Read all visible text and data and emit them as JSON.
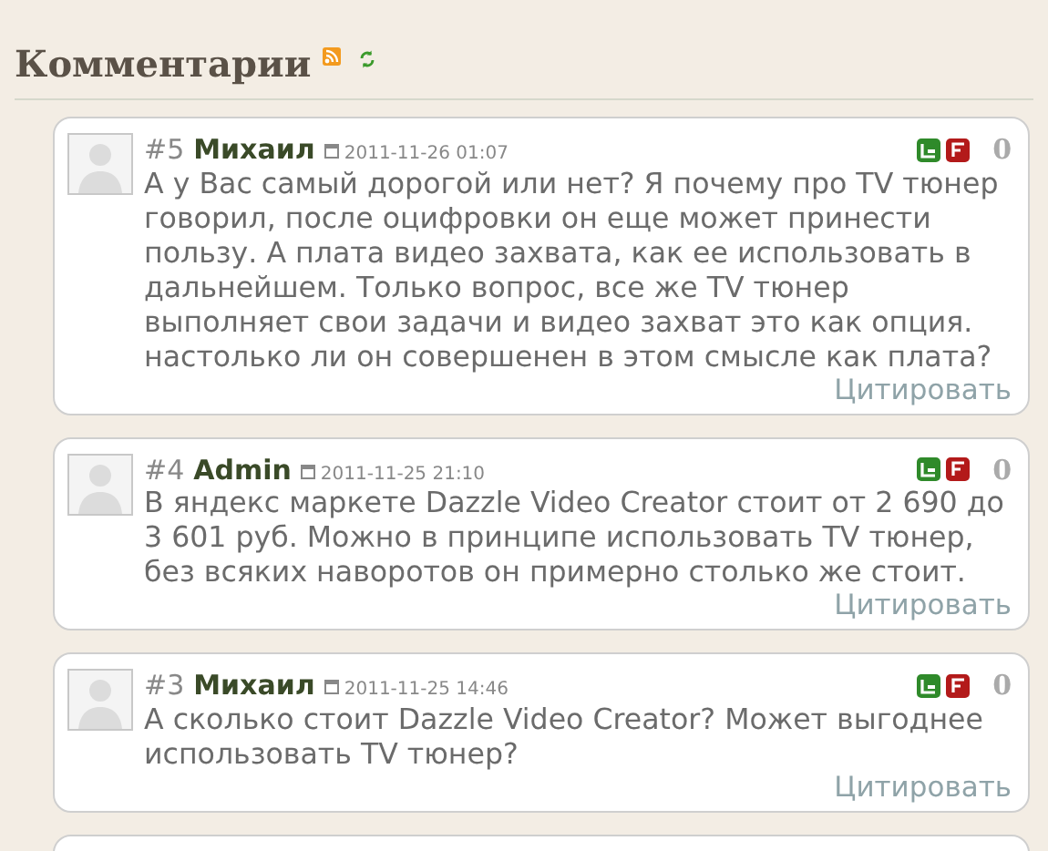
{
  "section": {
    "title": "Комментарии"
  },
  "comments": [
    {
      "number": "#5",
      "author": "Михаил",
      "date": "2011-11-26 01:07",
      "rating": "0",
      "text": "А у Вас самый дорогой или нет? Я почему про TV тюнер говорил, после оцифровки он еще может принести пользу. А плата видео захвата, как ее использовать в дальнейшем. Только вопрос, все же TV тюнер выполняет свои задачи и видео захват это как опция. настолько ли он совершенен в этом смысле как плата?",
      "quote": "Цитировать"
    },
    {
      "number": "#4",
      "author": "Admin",
      "date": "2011-11-25 21:10",
      "rating": "0",
      "text": "В яндекс маркете Dazzle Video Creator стоит от 2 690 до 3 601 руб. Можно в принципе использовать TV тюнер, без всяких наворотов он примерно столько же стоит.",
      "quote": "Цитировать"
    },
    {
      "number": "#3",
      "author": "Михаил",
      "date": "2011-11-25 14:46",
      "rating": "0",
      "text": "А сколько стоит Dazzle Video Creator? Может выгоднее использовать TV тюнер?",
      "quote": "Цитировать"
    }
  ]
}
